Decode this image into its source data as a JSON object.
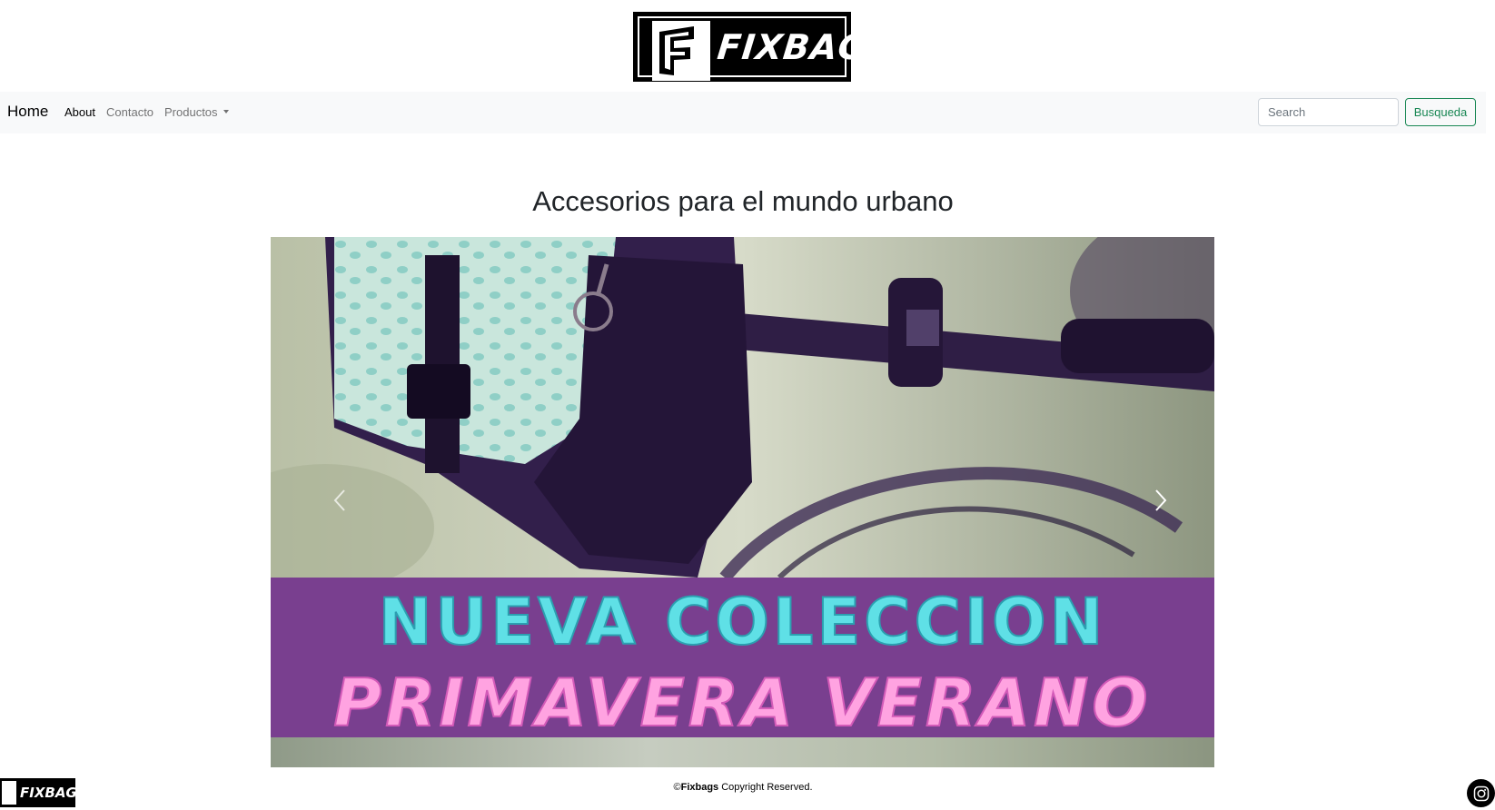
{
  "header": {
    "logo_text": "FIXBAGS"
  },
  "nav": {
    "brand": "Home",
    "items": [
      {
        "label": "About",
        "active": true
      },
      {
        "label": "Contacto",
        "active": false
      },
      {
        "label": "Productos",
        "active": false,
        "dropdown": true
      }
    ],
    "search": {
      "placeholder": "Search",
      "value": "",
      "button_label": "Busqueda"
    }
  },
  "main": {
    "title": "Accesorios para el mundo urbano",
    "carousel": {
      "banner_line1": "NUEVA COLECCION",
      "banner_line2": "PRIMAVERA VERANO",
      "prev_icon": "chevron-left-icon",
      "next_icon": "chevron-right-icon"
    }
  },
  "footer": {
    "logo_text": "FIXBAGS",
    "copyright_symbol": "©",
    "copyright_brand": "Fixbags",
    "copyright_text": " Copyright Reserved.",
    "social_icon": "instagram-icon"
  },
  "colors": {
    "nav_bg": "#f8f9fa",
    "success": "#198754",
    "banner_bg": "#793f8f",
    "banner_cyan": "#5fe0e6",
    "banner_pink": "#ffa3e1"
  }
}
